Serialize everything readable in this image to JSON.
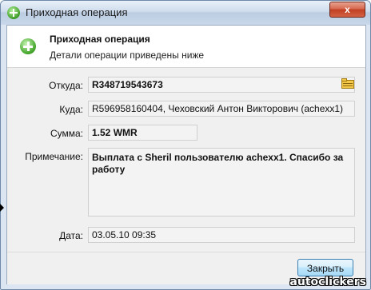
{
  "window": {
    "title": "Приходная операция",
    "close_label": "x"
  },
  "header": {
    "title": "Приходная операция",
    "subtitle": "Детали операции приведены ниже"
  },
  "fields": {
    "from_label": "Откуда:",
    "from_value": "R348719543673",
    "to_label": "Куда:",
    "to_value": "R596958160404, Чеховский Антон Викторович (achexx1)",
    "amount_label": "Сумма:",
    "amount_value": "1.52 WMR",
    "note_label": "Примечание:",
    "note_value": "Выплата с Sheril пользователю achexx1. Спасибо за работу",
    "date_label": "Дата:",
    "date_value": "03.05.10 09:35"
  },
  "footer": {
    "close_button": "Закрыть"
  },
  "watermark": "autoclickers",
  "colors": {
    "accent_green": "#3d9b25",
    "close_red": "#c13f22",
    "window_frame": "#6f8aa9"
  }
}
